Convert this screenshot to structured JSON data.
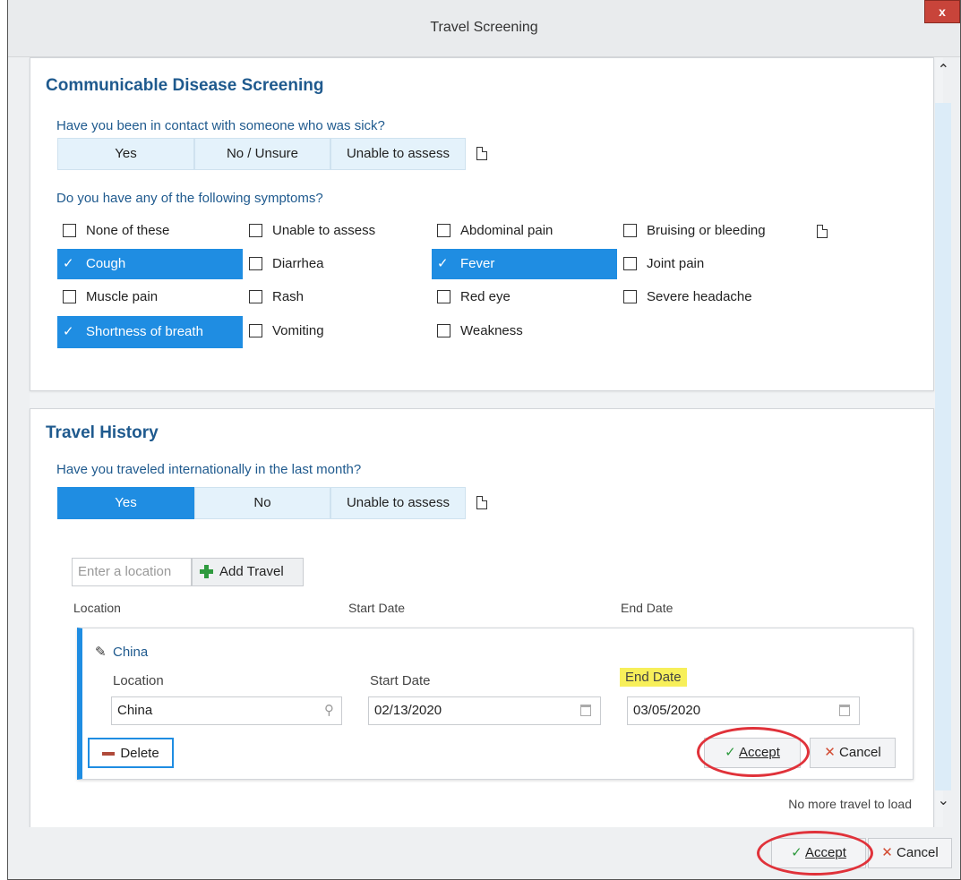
{
  "window": {
    "title": "Travel Screening",
    "close_label": "x"
  },
  "communicable": {
    "title": "Communicable Disease Screening",
    "question": "Have you been in contact with someone who was sick?",
    "options": [
      "Yes",
      "No / Unsure",
      "Unable to assess"
    ],
    "symptoms_question": "Do you have any of the following symptoms?",
    "symptoms": [
      {
        "label": "None of these",
        "checked": false
      },
      {
        "label": "Unable to assess",
        "checked": false
      },
      {
        "label": "Abdominal pain",
        "checked": false
      },
      {
        "label": "Bruising or bleeding",
        "checked": false
      },
      {
        "label": "Cough",
        "checked": true
      },
      {
        "label": "Diarrhea",
        "checked": false
      },
      {
        "label": "Fever",
        "checked": true
      },
      {
        "label": "Joint pain",
        "checked": false
      },
      {
        "label": "Muscle pain",
        "checked": false
      },
      {
        "label": "Rash",
        "checked": false
      },
      {
        "label": "Red eye",
        "checked": false
      },
      {
        "label": "Severe headache",
        "checked": false
      },
      {
        "label": "Shortness of breath",
        "checked": true
      },
      {
        "label": "Vomiting",
        "checked": false
      },
      {
        "label": "Weakness",
        "checked": false
      }
    ]
  },
  "travel": {
    "title": "Travel History",
    "question": "Have you traveled internationally in the last month?",
    "options": [
      "Yes",
      "No",
      "Unable to assess"
    ],
    "selected_option": "Yes",
    "location_placeholder": "Enter a location",
    "add_travel_label": "Add Travel",
    "columns": [
      "Location",
      "Start Date",
      "End Date"
    ],
    "entry": {
      "name": "China",
      "location_label": "Location",
      "location_value": "China",
      "start_label": "Start Date",
      "start_value": "02/13/2020",
      "end_label": "End Date",
      "end_value": "03/05/2020",
      "delete_label": "Delete",
      "accept_label": "Accept",
      "cancel_label": "Cancel"
    },
    "no_more": "No more travel to load"
  },
  "footer": {
    "accept_label": "Accept",
    "cancel_label": "Cancel"
  },
  "colors": {
    "selected": "#1f8de2",
    "heading": "#1f5a8e",
    "ring": "#e0323a",
    "highlight": "#f7ef5a"
  }
}
